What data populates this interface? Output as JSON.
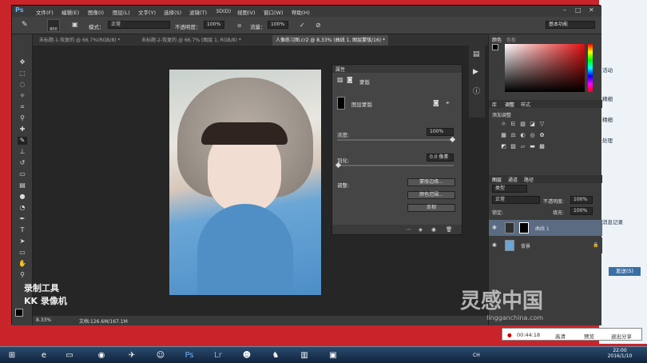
{
  "ps": {
    "logo": "Ps",
    "menus": [
      "文件(F)",
      "编辑(E)",
      "图像(I)",
      "图层(L)",
      "文字(Y)",
      "选择(S)",
      "滤镜(T)",
      "3D(D)",
      "视图(V)",
      "窗口(W)",
      "帮助(H)"
    ],
    "options": {
      "brush_size": "800",
      "mode_label": "模式：",
      "mode_value": "正常",
      "opacity_label": "不透明度：",
      "opacity_value": "100%",
      "flow_label": "流量：",
      "flow_value": "100%",
      "workspace": "基本功能"
    },
    "tabs": [
      "未标题-1-恢复的 @ 66.7%(RGB/8) *",
      "未标题-2-恢复的 @ 66.7% (图层 1, RGB/8) *",
      "人像练习图.cr2 @ 8.33% (曲线 1, 图层蒙版/16) *"
    ],
    "status": {
      "zoom": "8.33%",
      "doc": "文档:126.6M/167.1M"
    }
  },
  "properties": {
    "title": "属性",
    "mask_label": "蒙版",
    "layer_mask_label": "图层蒙版",
    "density_label": "浓度:",
    "density_value": "100%",
    "feather_label": "羽化:",
    "feather_value": "0.0 像素",
    "refine_label": "调整:",
    "btn_edge": "蒙版边缘...",
    "btn_color_range": "颜色范围...",
    "btn_invert": "反相"
  },
  "right": {
    "color_tab": "颜色",
    "swatch_tab": "色板",
    "adj_tabs": [
      "库",
      "调整",
      "样式"
    ],
    "adj_title": "添加调整",
    "layer_tabs": [
      "图层",
      "通道",
      "路径"
    ],
    "filter_kind": "类型",
    "blend_mode": "正常",
    "opacity_label": "不透明度:",
    "opacity_value": "100%",
    "lock_label": "锁定:",
    "fill_label": "填充:",
    "fill_value": "100%",
    "layers": [
      {
        "name": "曲线 1"
      },
      {
        "name": "背景"
      }
    ]
  },
  "watermark": {
    "line1": "录制工具",
    "line2": "KK 录像机",
    "brand": "灵感中国",
    "url": "lingganchina.com"
  },
  "recorder": {
    "time": "00:44:18",
    "btn_hd": "高清",
    "btn_preview": "预览",
    "btn_exit": "退出分享"
  },
  "chat": {
    "items": [
      "活动",
      "精细",
      "精细",
      "处理"
    ],
    "history": "消息记录",
    "send": "发送(S)"
  },
  "taskbar": {
    "time": "22:00",
    "date": "2016/1/10",
    "lang": "CH"
  },
  "colors": {
    "accent": "#3a6ea5",
    "win_bg": "#c9242a"
  }
}
